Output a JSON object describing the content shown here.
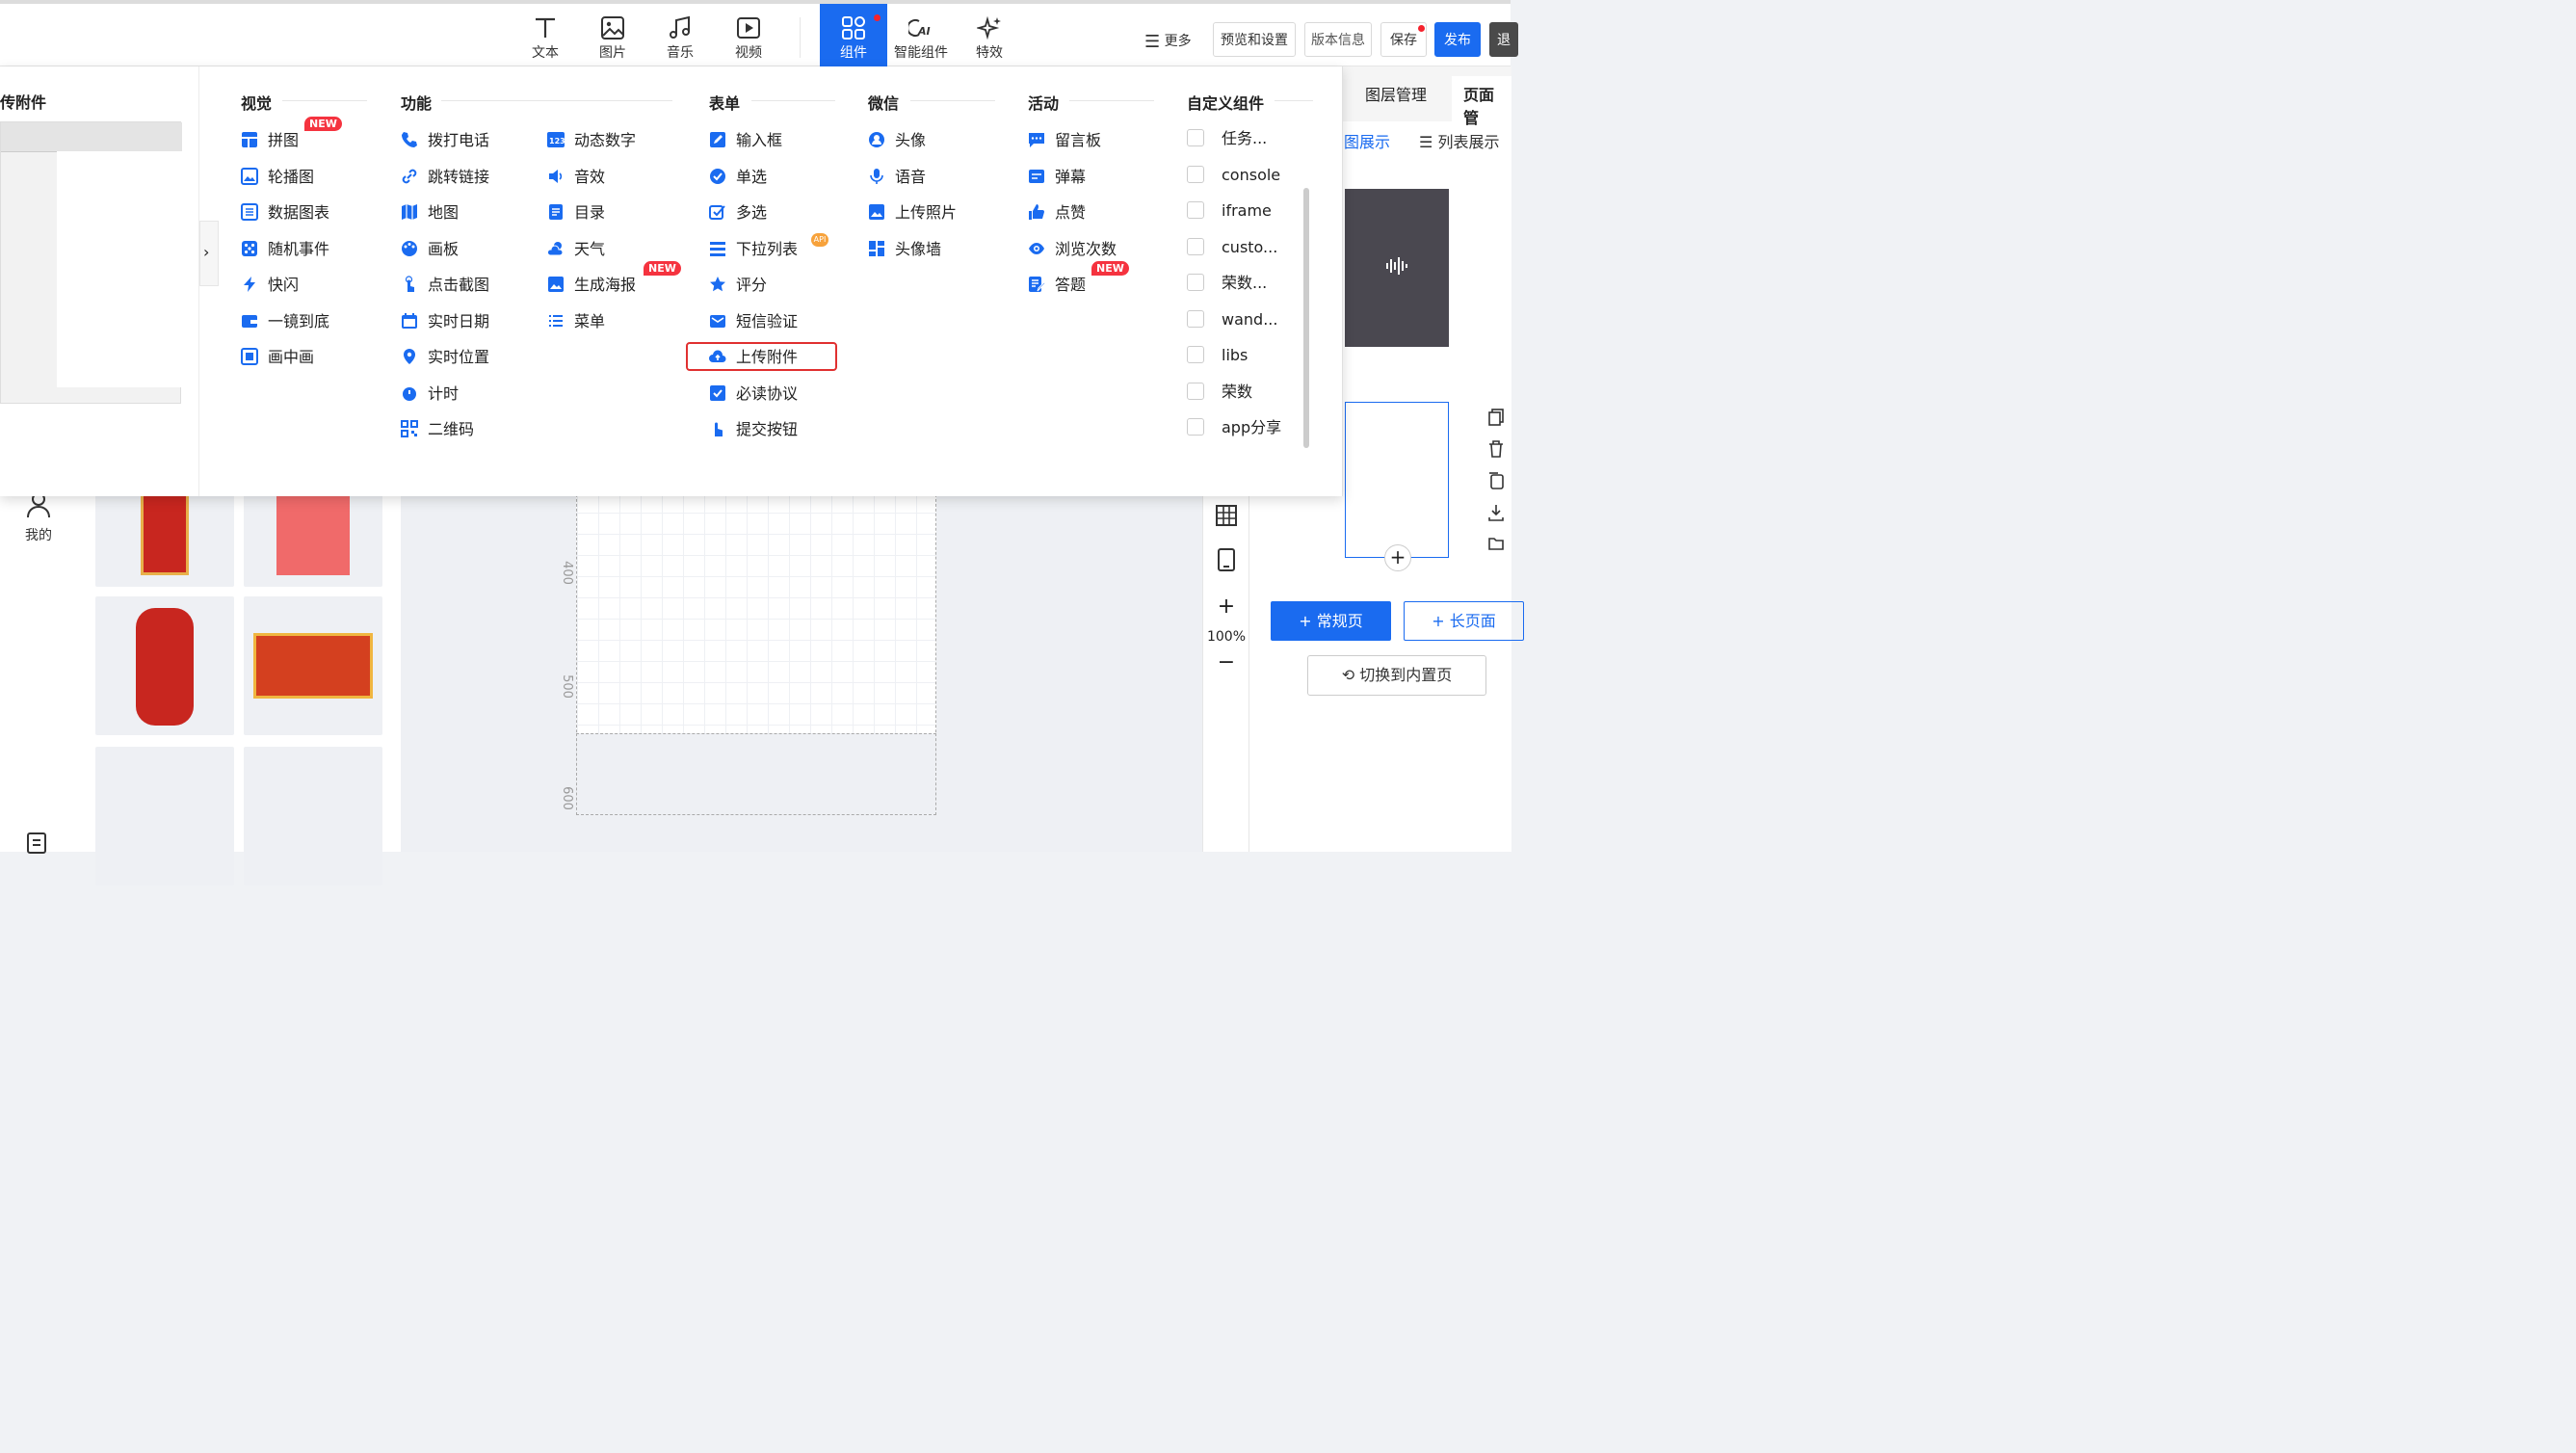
{
  "toolbar": {
    "tools": [
      {
        "label": "文本",
        "icon": "text-icon"
      },
      {
        "label": "图片",
        "icon": "image-icon"
      },
      {
        "label": "音乐",
        "icon": "music-icon"
      },
      {
        "label": "视频",
        "icon": "video-icon"
      },
      {
        "label": "组件",
        "icon": "components-icon",
        "active": true
      },
      {
        "label": "智能组件",
        "icon": "ai-icon"
      },
      {
        "label": "特效",
        "icon": "sparkle-icon"
      }
    ],
    "more_label": "更多",
    "preview_settings": "预览和设置",
    "version_info": "版本信息",
    "save": "保存",
    "publish": "发布",
    "exit": "退"
  },
  "dropdown": {
    "preview_title": "传附件",
    "categories": [
      {
        "title": "视觉",
        "items": [
          "拼图",
          "轮播图",
          "数据图表",
          "随机事件",
          "快闪",
          "一镜到底",
          "画中画"
        ]
      },
      {
        "title": "功能",
        "col1": [
          "拨打电话",
          "跳转链接",
          "地图",
          "画板",
          "点击截图",
          "实时日期",
          "实时位置",
          "计时",
          "二维码"
        ],
        "col2": [
          "动态数字",
          "音效",
          "目录",
          "天气",
          "生成海报",
          "菜单"
        ]
      },
      {
        "title": "表单",
        "items": [
          "输入框",
          "单选",
          "多选",
          "下拉列表",
          "评分",
          "短信验证",
          "上传附件",
          "必读协议",
          "提交按钮"
        ]
      },
      {
        "title": "微信",
        "items": [
          "头像",
          "语音",
          "上传照片",
          "头像墙"
        ]
      },
      {
        "title": "活动",
        "items": [
          "留言板",
          "弹幕",
          "点赞",
          "浏览次数",
          "答题"
        ]
      },
      {
        "title": "自定义组件",
        "items": [
          "任务...",
          "console",
          "iframe",
          "custo...",
          "荣数...",
          "wand...",
          "libs",
          "荣数",
          "app分享"
        ]
      }
    ],
    "new_badge": "NEW",
    "api_badge": "API"
  },
  "left_nav": {
    "mine": "我的"
  },
  "canvas": {
    "ruler": [
      "400",
      "500",
      "600"
    ],
    "zoom": "100%"
  },
  "right_panel": {
    "tab_layers": "图层管理",
    "tab_pages": "页面管",
    "view_grid": "图展示",
    "view_list": "列表展示",
    "add_normal_page": "+ 常规页",
    "add_long_page": "+ 长页面",
    "switch_builtin": "切换到内置页"
  },
  "colors": {
    "accent": "#1a6bf0",
    "badge": "#f5333f",
    "highlight": "#e03030"
  }
}
